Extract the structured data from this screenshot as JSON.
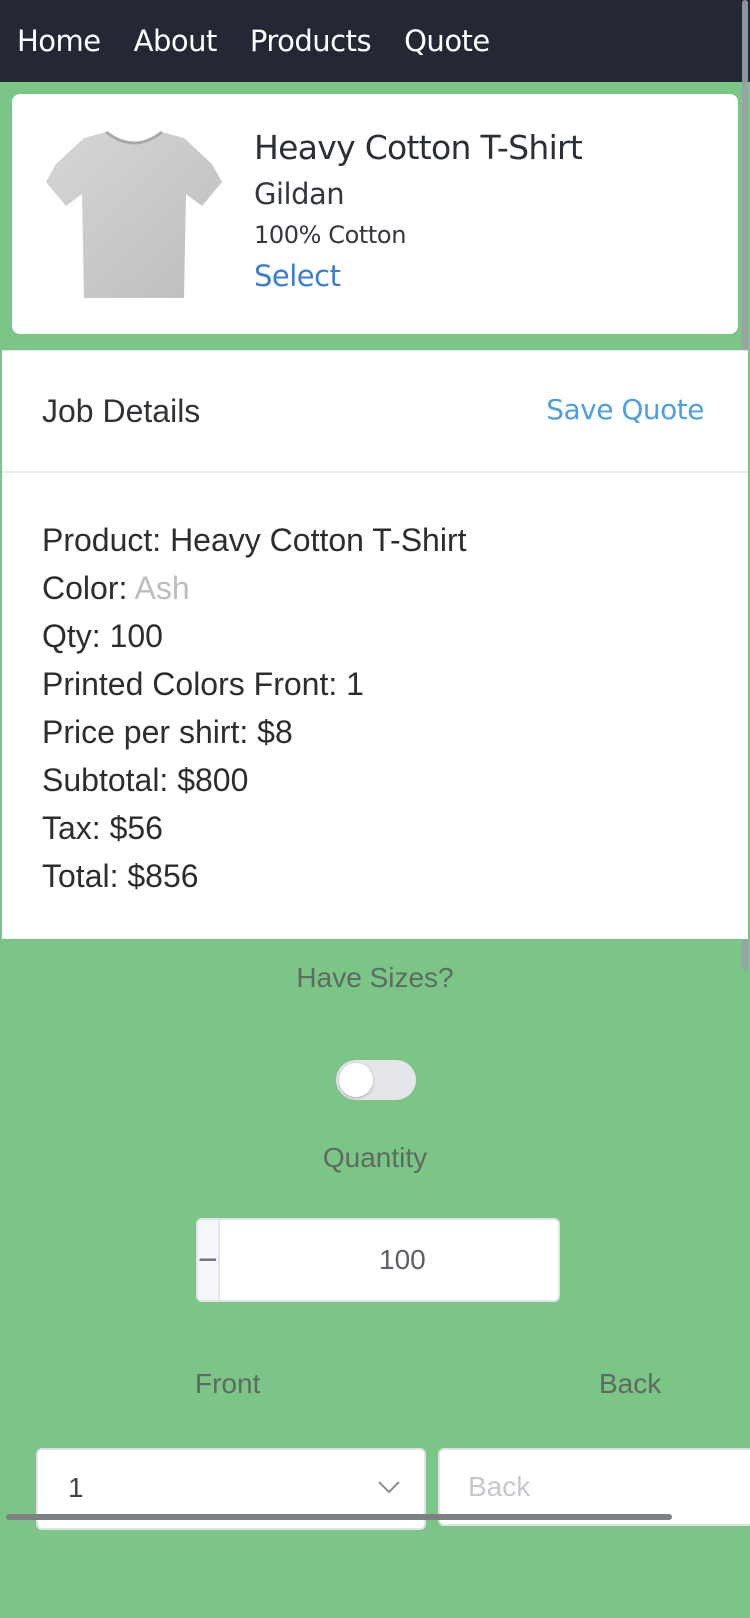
{
  "nav": {
    "items": [
      "Home",
      "About",
      "Products",
      "Quote"
    ]
  },
  "product": {
    "name": "Heavy Cotton T-Shirt",
    "brand": "Gildan",
    "material": "100% Cotton",
    "select_label": "Select",
    "image_icon": "tshirt-icon"
  },
  "job": {
    "title": "Job Details",
    "save_label": "Save Quote",
    "product_label": "Product: ",
    "product_value": "Heavy Cotton T-Shirt",
    "color_label": "Color: ",
    "color_value": "Ash",
    "qty_line": "Qty: 100",
    "printed_line": "Printed Colors Front: 1",
    "price_line": "Price per shirt: $8",
    "subtotal_line": "Subtotal: $800",
    "tax_line": "Tax: $56",
    "total_line": "Total: $856"
  },
  "sizes": {
    "label": "Have Sizes?",
    "enabled": false
  },
  "quantity": {
    "label": "Quantity",
    "value": "100",
    "minus_symbol": "−",
    "plus_symbol": "+"
  },
  "print": {
    "front_label": "Front",
    "back_label": "Back",
    "front_value": "1",
    "back_placeholder": "Back"
  },
  "colors": {
    "background": "#7bc587",
    "nav": "#242834",
    "accent": "#3d7bd4",
    "save": "#4aa0e6"
  }
}
